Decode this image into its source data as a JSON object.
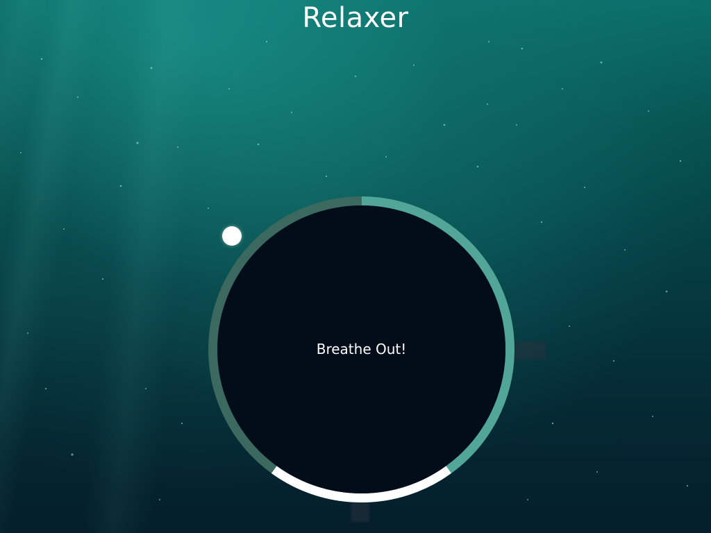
{
  "app": {
    "title": "Relaxer"
  },
  "breathe": {
    "instruction": "Breathe Out!"
  },
  "colors": {
    "title": "#ffffff",
    "circle_fill": "#030d1a",
    "ring_breathe_in": "#52a697",
    "ring_hold": "#ffffff",
    "ring_breathe_out": "#3b695f",
    "pointer": "#ffffff"
  },
  "ring": {
    "segments": [
      {
        "phase": "breathe-in",
        "fraction": 0.4
      },
      {
        "phase": "hold",
        "fraction": 0.2
      },
      {
        "phase": "breathe-out",
        "fraction": 0.4
      }
    ]
  }
}
